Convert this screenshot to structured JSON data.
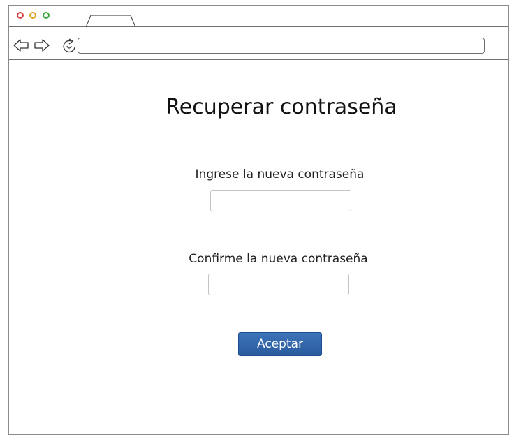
{
  "browser": {
    "window_controls": {
      "close_color": "#d64545",
      "minimize_color": "#e0a020",
      "maximize_color": "#3aa83a"
    },
    "nav_icons": [
      "back-arrow-icon",
      "forward-arrow-icon",
      "reload-icon"
    ],
    "address": ""
  },
  "page": {
    "title": "Recuperar contraseña",
    "new_password": {
      "label": "Ingrese la nueva contraseña",
      "value": ""
    },
    "confirm_password": {
      "label": "Confirme la nueva contraseña",
      "value": ""
    },
    "accept_label": "Aceptar",
    "accent_color": "#2f63a8"
  }
}
